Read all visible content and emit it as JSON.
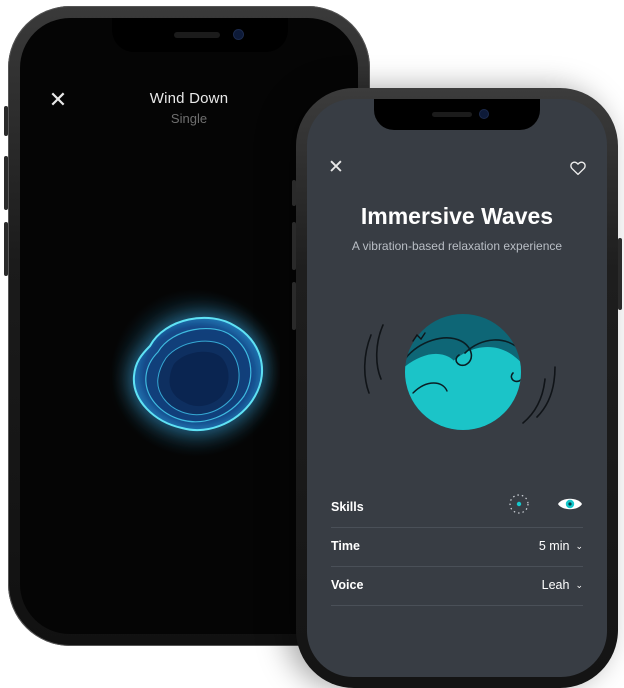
{
  "back_phone": {
    "close_icon": "close-icon",
    "title": "Wind Down",
    "subtitle": "Single",
    "visual": "glowing-blob-animation",
    "accent_color": "#34c6e8"
  },
  "front_phone": {
    "close_icon": "close-icon",
    "favorite_icon": "heart-icon",
    "title": "Immersive Waves",
    "subtitle": "A vibration-based relaxation experience",
    "illustration": "wave-icon",
    "background_color": "#383d44",
    "accent_color": "#15c8cc",
    "rows": [
      {
        "label": "Skills",
        "icons": [
          "focus-dots-icon",
          "eye-icon"
        ]
      },
      {
        "label": "Time",
        "value": "5 min",
        "icon": "chevron-down-icon"
      },
      {
        "label": "Voice",
        "value": "Leah",
        "icon": "chevron-down-icon"
      }
    ]
  }
}
